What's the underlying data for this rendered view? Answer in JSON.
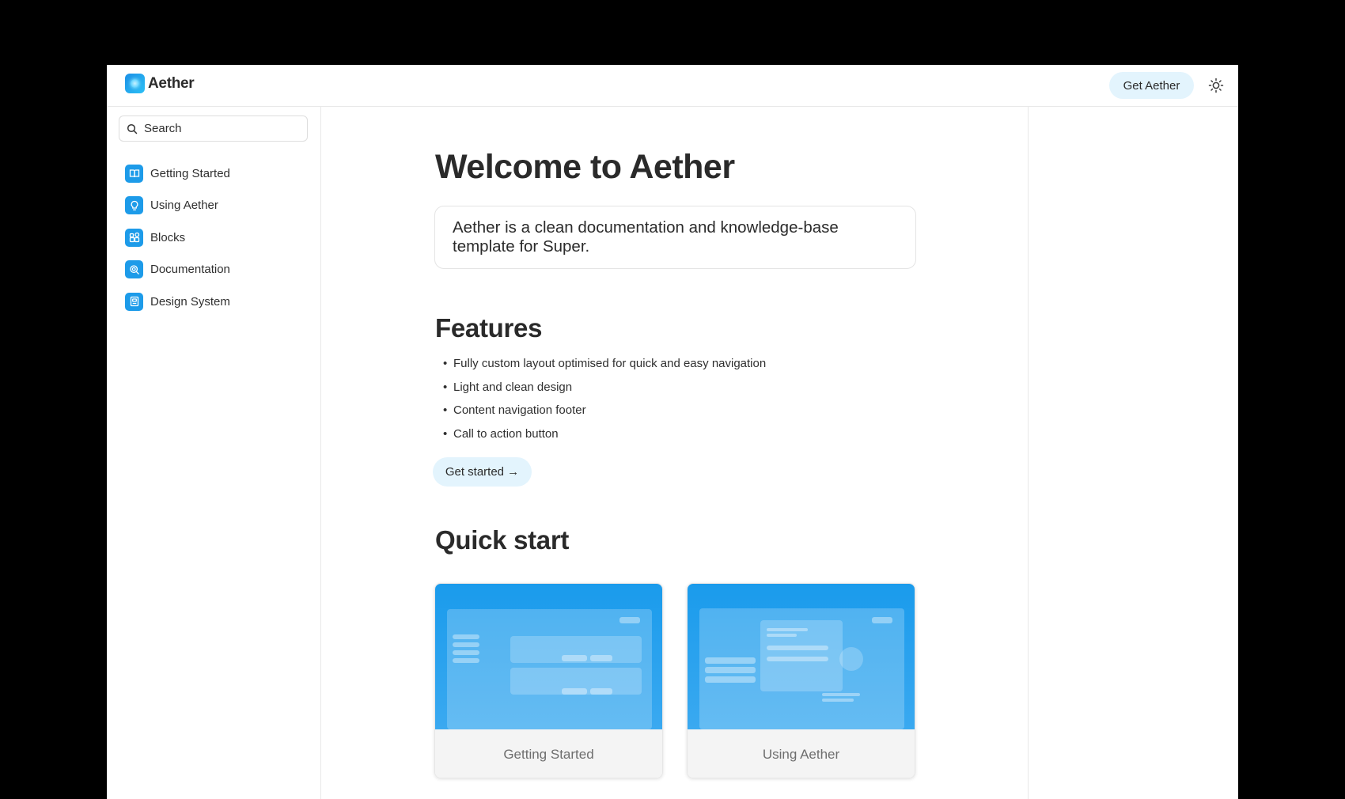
{
  "app": {
    "name": "Aether",
    "logo_icon": "aether-logo-icon"
  },
  "header": {
    "cta_label": "Get Aether",
    "theme_icon": "sun-icon"
  },
  "sidebar": {
    "search_placeholder": "Search",
    "items": [
      {
        "label": "Getting Started",
        "icon": "book-icon"
      },
      {
        "label": "Using Aether",
        "icon": "lightbulb-icon"
      },
      {
        "label": "Blocks",
        "icon": "blocks-icon"
      },
      {
        "label": "Documentation",
        "icon": "search-doc-icon"
      },
      {
        "label": "Design System",
        "icon": "design-doc-icon"
      }
    ]
  },
  "main": {
    "title": "Welcome to Aether",
    "intro": "Aether is a clean documentation and knowledge-base template for Super.",
    "features_title": "Features",
    "features": [
      "Fully custom layout optimised for quick and easy navigation",
      "Light and clean design",
      "Content navigation footer",
      "Call to action button"
    ],
    "cta_label": "Get started →",
    "quick_start_title": "Quick start",
    "cards": [
      {
        "label": "Getting Started"
      },
      {
        "label": "Using Aether"
      }
    ]
  },
  "colors": {
    "accent": "#1d9be9",
    "button_bg": "#e3f4fd",
    "border": "#e8e8e8"
  }
}
